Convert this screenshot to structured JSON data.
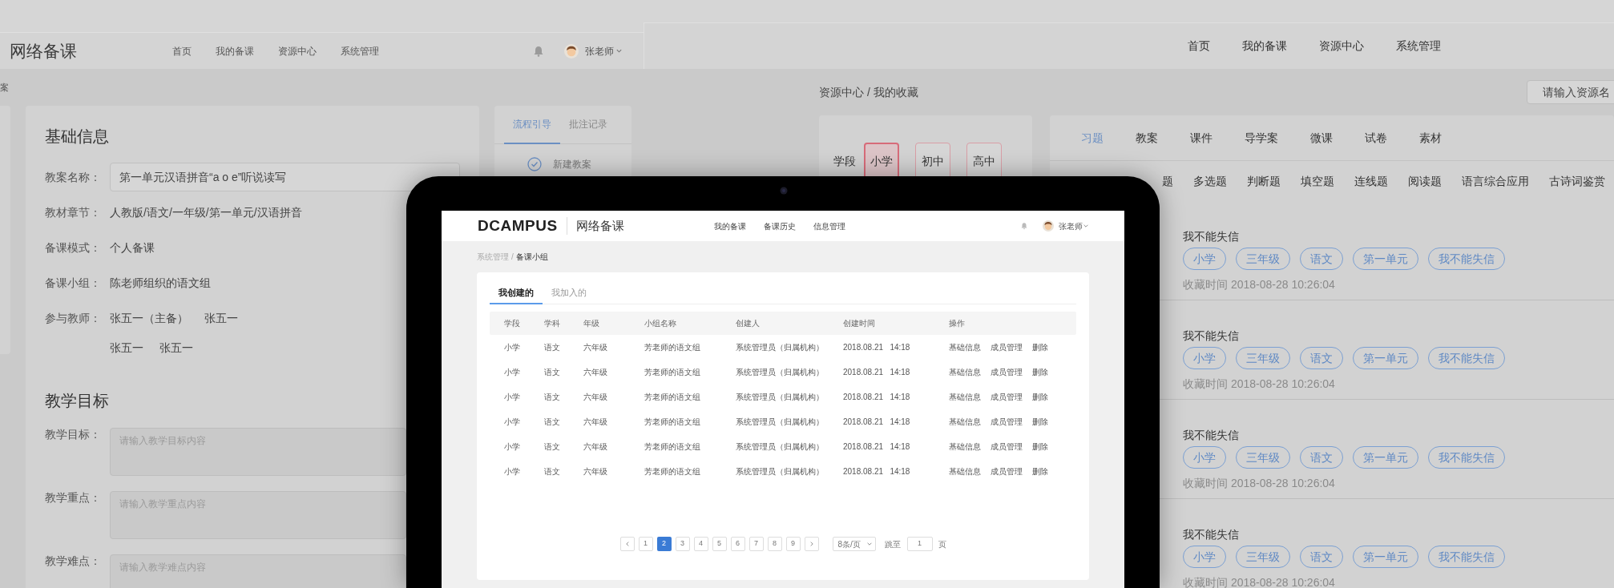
{
  "left_screen": {
    "app_title": "网络备课",
    "nav": [
      "首页",
      "我的备课",
      "资源中心",
      "系统管理"
    ],
    "user": "张老师",
    "breadcrumb": "案",
    "basic_info": {
      "title": "基础信息",
      "fields": [
        {
          "label": "教案名称：",
          "kind": "input",
          "value": "第一单元汉语拼音“a o e”听说读写"
        },
        {
          "label": "教材章节：",
          "kind": "text",
          "value": "人教版/语文/一年级/第一单元/汉语拼音"
        },
        {
          "label": "备课模式：",
          "kind": "text",
          "value": "个人备课"
        },
        {
          "label": "备课小组：",
          "kind": "text",
          "value": "陈老师组织的语文组"
        },
        {
          "label": "参与教师：",
          "kind": "names",
          "values": [
            "张五一（主备）",
            "张五一",
            "张五一",
            "张五一"
          ]
        }
      ]
    },
    "goals": {
      "title": "教学目标",
      "fields": [
        {
          "label": "教学目标：",
          "placeholder": "请输入教学目标内容"
        },
        {
          "label": "教学重点：",
          "placeholder": "请输入教学重点内容"
        },
        {
          "label": "教学难点：",
          "placeholder": "请输入教学难点内容"
        }
      ]
    },
    "side_tabs": [
      {
        "label": "流程引导",
        "selected": true
      },
      {
        "label": "批注记录",
        "selected": false
      }
    ],
    "steps": [
      "新建教案"
    ]
  },
  "right_screen": {
    "nav": [
      "首页",
      "我的备课",
      "资源中心",
      "系统管理"
    ],
    "breadcrumb": "资源中心 / 我的收藏",
    "search": {
      "placeholder": "请输入资源名"
    },
    "stage": {
      "label": "学段",
      "options": [
        {
          "label": "小学",
          "selected": true
        },
        {
          "label": "初中",
          "selected": false
        },
        {
          "label": "高中",
          "selected": false
        }
      ]
    },
    "tabs": [
      {
        "label": "习题",
        "selected": true
      },
      {
        "label": "教案",
        "selected": false
      },
      {
        "label": "课件",
        "selected": false
      },
      {
        "label": "导学案",
        "selected": false
      },
      {
        "label": "微课",
        "selected": false
      },
      {
        "label": "试卷",
        "selected": false
      },
      {
        "label": "素材",
        "selected": false
      }
    ],
    "question_types": [
      "题",
      "多选题",
      "判断题",
      "填空题",
      "连线题",
      "阅读题",
      "语言综合应用",
      "古诗词鉴赏"
    ],
    "items": [
      {
        "title": "我不能失信",
        "tags": [
          "小学",
          "三年级",
          "语文",
          "第一单元",
          "我不能失信"
        ],
        "time": "收藏时间 2018-08-28 10:26:04"
      },
      {
        "title": "我不能失信",
        "tags": [
          "小学",
          "三年级",
          "语文",
          "第一单元",
          "我不能失信"
        ],
        "time": "收藏时间 2018-08-28 10:26:04"
      },
      {
        "title": "我不能失信",
        "tags": [
          "小学",
          "三年级",
          "语文",
          "第一单元",
          "我不能失信"
        ],
        "time": "收藏时间 2018-08-28 10:26:04"
      },
      {
        "title": "我不能失信",
        "tags": [
          "小学",
          "三年级",
          "语文",
          "第一单元",
          "我不能失信"
        ],
        "time": "收藏时间 2018-08-28 10:26:04"
      }
    ]
  },
  "device_screen": {
    "logo": "DCAMPUS",
    "app_title": "网络备课",
    "nav": [
      "我的备课",
      "备课历史",
      "信息管理"
    ],
    "user": "张老师",
    "breadcrumb": {
      "parent": "系统管理",
      "separator": "/",
      "current": "备课小组"
    },
    "tabs": [
      {
        "label": "我创建的",
        "selected": true
      },
      {
        "label": "我加入的",
        "selected": false
      }
    ],
    "table": {
      "columns": [
        "学段",
        "学科",
        "年级",
        "小组名称",
        "创建人",
        "创建时间",
        "操作"
      ],
      "rows": [
        {
          "cells": [
            "小学",
            "语文",
            "六年级",
            "芳老师的语文组",
            "系统管理员（归属机构）",
            "2018.08.21   14:18"
          ],
          "actions": [
            "基础信息",
            "成员管理",
            "删除"
          ]
        },
        {
          "cells": [
            "小学",
            "语文",
            "六年级",
            "芳老师的语文组",
            "系统管理员（归属机构）",
            "2018.08.21   14:18"
          ],
          "actions": [
            "基础信息",
            "成员管理",
            "删除"
          ]
        },
        {
          "cells": [
            "小学",
            "语文",
            "六年级",
            "芳老师的语文组",
            "系统管理员（归属机构）",
            "2018.08.21   14:18"
          ],
          "actions": [
            "基础信息",
            "成员管理",
            "删除"
          ]
        },
        {
          "cells": [
            "小学",
            "语文",
            "六年级",
            "芳老师的语文组",
            "系统管理员（归属机构）",
            "2018.08.21   14:18"
          ],
          "actions": [
            "基础信息",
            "成员管理",
            "删除"
          ]
        },
        {
          "cells": [
            "小学",
            "语文",
            "六年级",
            "芳老师的语文组",
            "系统管理员（归属机构）",
            "2018.08.21   14:18"
          ],
          "actions": [
            "基础信息",
            "成员管理",
            "删除"
          ]
        },
        {
          "cells": [
            "小学",
            "语文",
            "六年级",
            "芳老师的语文组",
            "系统管理员（归属机构）",
            "2018.08.21   14:18"
          ],
          "actions": [
            "基础信息",
            "成员管理",
            "删除"
          ]
        }
      ]
    },
    "pagination": {
      "pages": [
        {
          "label": "1",
          "selected": false
        },
        {
          "label": "2",
          "selected": true
        },
        {
          "label": "3",
          "selected": false
        },
        {
          "label": "4",
          "selected": false
        },
        {
          "label": "5",
          "selected": false
        },
        {
          "label": "6",
          "selected": false
        },
        {
          "label": "7",
          "selected": false
        },
        {
          "label": "8",
          "selected": false
        },
        {
          "label": "9",
          "selected": false
        }
      ],
      "page_size": "8条/页",
      "jump_label": "跳至",
      "jump_value": "1",
      "page_suffix": "页"
    }
  }
}
